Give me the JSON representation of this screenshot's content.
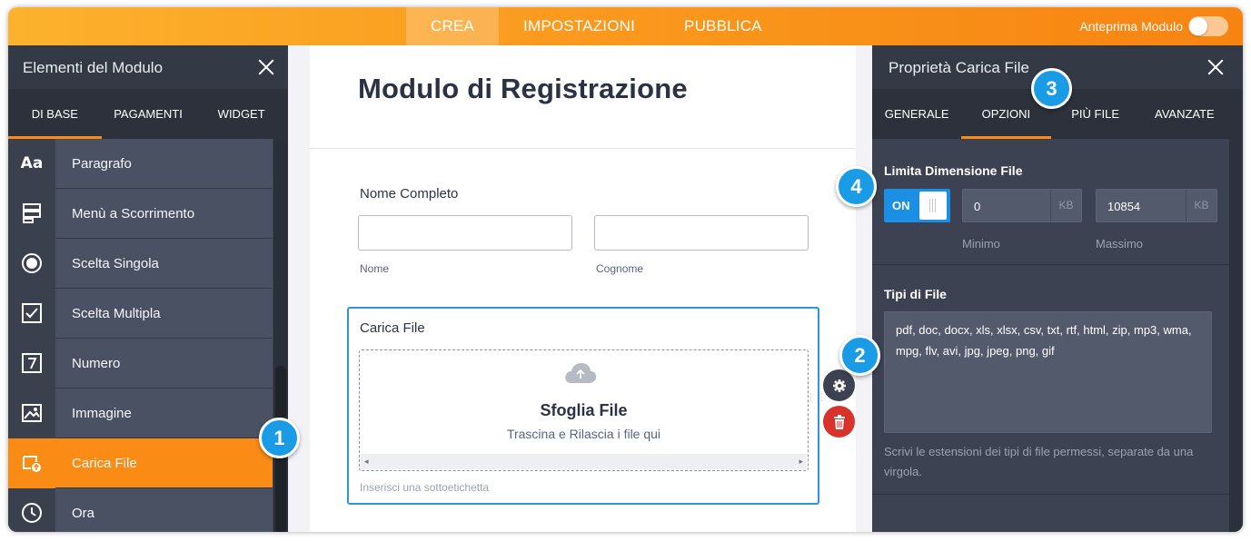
{
  "topbar": {
    "tabs": [
      {
        "label": "CREA",
        "active": true
      },
      {
        "label": "IMPOSTAZIONI",
        "active": false
      },
      {
        "label": "PUBBLICA",
        "active": false
      }
    ],
    "preview_label": "Anteprima Modulo",
    "preview_enabled": false
  },
  "left_panel": {
    "title": "Elementi del Modulo",
    "tabs": [
      "DI BASE",
      "PAGAMENTI",
      "WIDGET"
    ],
    "items": [
      {
        "label": "Paragrafo",
        "icon": "paragraph-icon"
      },
      {
        "label": "Menù a Scorrimento",
        "icon": "dropdown-icon"
      },
      {
        "label": "Scelta Singola",
        "icon": "radio-icon"
      },
      {
        "label": "Scelta Multipla",
        "icon": "checkbox-icon"
      },
      {
        "label": "Numero",
        "icon": "number-icon"
      },
      {
        "label": "Immagine",
        "icon": "image-icon"
      },
      {
        "label": "Carica File",
        "icon": "file-upload-icon",
        "active": true
      },
      {
        "label": "Ora",
        "icon": "clock-icon"
      }
    ]
  },
  "form": {
    "title": "Modulo di Registrazione",
    "full_name": {
      "label": "Nome Completo",
      "first_sublabel": "Nome",
      "last_sublabel": "Cognome"
    },
    "upload": {
      "label": "Carica File",
      "browse": "Sfoglia File",
      "drag": "Trascina e Rilascia i file qui",
      "sublabel_placeholder": "Inserisci una sottoetichetta"
    }
  },
  "right_panel": {
    "title": "Proprietà Carica File",
    "tabs": [
      "GENERALE",
      "OPZIONI",
      "PIÙ FILE",
      "AVANZATE"
    ],
    "limit": {
      "title": "Limita Dimensione File",
      "toggle": "ON",
      "min_value": "0",
      "min_unit": "KB",
      "min_label": "Minimo",
      "max_value": "10854",
      "max_unit": "KB",
      "max_label": "Massimo"
    },
    "file_types": {
      "title": "Tipi di File",
      "value": "pdf, doc, docx, xls, xlsx, csv, txt, rtf, html, zip, mp3, wma, mpg, flv, avi, jpg, jpeg, png, gif",
      "hint": "Scrivi le estensioni dei tipi di file permessi, separate da una virgola."
    }
  },
  "badges": [
    "1",
    "2",
    "3",
    "4"
  ],
  "colors": {
    "accent": "#fa8c16",
    "blue": "#1a9be5",
    "panel": "#3c4251",
    "delete": "#d9322b"
  }
}
